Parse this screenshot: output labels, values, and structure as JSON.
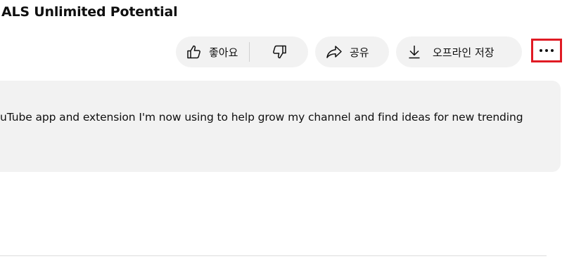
{
  "channel": {
    "title": "ALS Unlimited Potential"
  },
  "actions": {
    "like_label": "좋아요",
    "share_label": "공유",
    "download_label": "오프라인 저장",
    "like_icon": "thumbs-up-icon",
    "dislike_icon": "thumbs-down-icon",
    "share_icon": "share-arrow-icon",
    "download_icon": "download-icon",
    "more_icon": "more-horizontal-icon"
  },
  "description": {
    "text": "uTube app and extension I'm now using to help grow my channel and find ideas for new trending"
  },
  "colors": {
    "pill_background": "#f2f2f2",
    "highlight_border": "#e01b24",
    "text": "#0f0f0f"
  }
}
